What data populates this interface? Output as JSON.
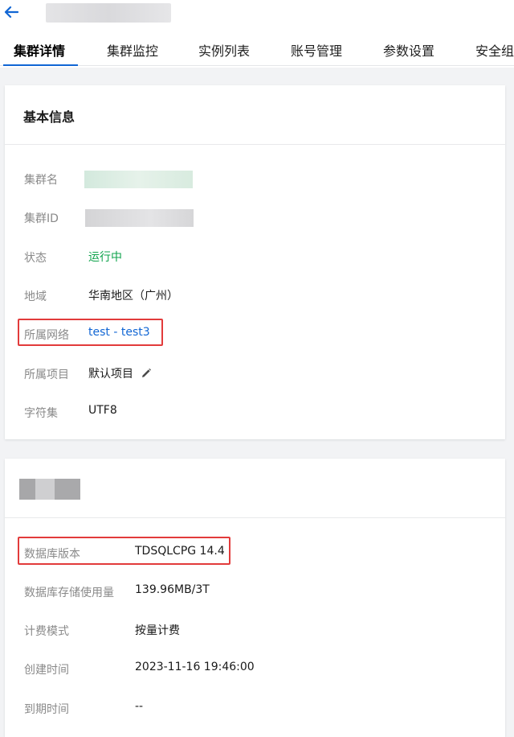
{
  "header": {
    "back_icon": "arrow-left-icon",
    "accent_color": "#1166d4"
  },
  "tabs": [
    {
      "label": "集群详情",
      "active": true
    },
    {
      "label": "集群监控"
    },
    {
      "label": "实例列表"
    },
    {
      "label": "账号管理"
    },
    {
      "label": "参数设置"
    },
    {
      "label": "安全组"
    }
  ],
  "basic_info": {
    "title": "基本信息",
    "rows": [
      {
        "label": "集群名",
        "value": ""
      },
      {
        "label": "集群ID",
        "value": ""
      },
      {
        "label": "状态",
        "value": "运行中"
      },
      {
        "label": "地域",
        "value": "华南地区（广州）"
      },
      {
        "label": "所属网络",
        "value": "test - test3"
      },
      {
        "label": "所属项目",
        "value": "默认项目"
      },
      {
        "label": "字符集",
        "value": "UTF8"
      }
    ],
    "status_color": "#0fa34c",
    "edit_icon": "pencil-icon"
  },
  "config_info": {
    "rows": [
      {
        "label": "数据库版本",
        "value": "TDSQLCPG 14.4"
      },
      {
        "label": "数据库存储使用量",
        "value": "139.96MB/3T"
      },
      {
        "label": "计费模式",
        "value": "按量计费"
      },
      {
        "label": "创建时间",
        "value": "2023-11-16 19:46:00"
      },
      {
        "label": "到期时间",
        "value": "--"
      }
    ]
  },
  "highlight_color": "#e23b3b"
}
